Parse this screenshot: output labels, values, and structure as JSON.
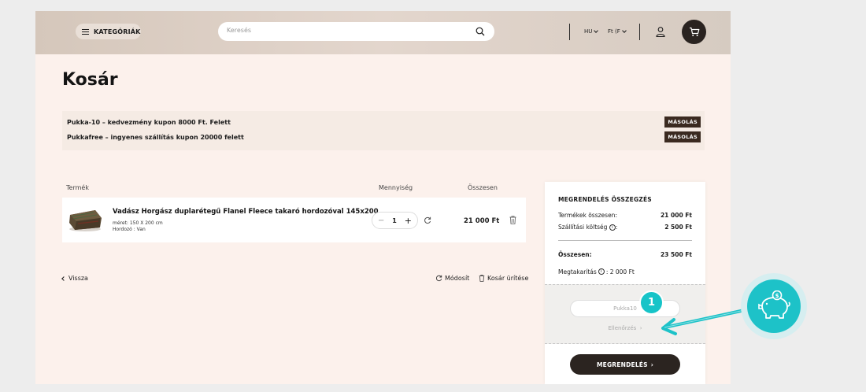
{
  "header": {
    "categories_label": "KATEGÓRIÁK",
    "search_placeholder": "Keresés",
    "language": "HU",
    "currency": "Ft (F"
  },
  "page_title": "Kosár",
  "coupons": [
    {
      "text": "Pukka-10 – kedvezmény kupon 8000 Ft. Felett",
      "button": "MÁSOLÁS"
    },
    {
      "text": "Pukkafree – ingyenes szállítás kupon 20000 felett",
      "button": "MÁSOLÁS"
    }
  ],
  "table": {
    "col_product": "Termék",
    "col_quantity": "Mennyiség",
    "col_total": "Összesen"
  },
  "product": {
    "name": "Vadász Horgász duplarétegű Flanel Fleece takaró hordozóval 145x200",
    "meta_size": "méret: 150 X 200 cm",
    "meta_carrier": "Hordozó : Van",
    "quantity": "1",
    "total": "21 000 Ft"
  },
  "actions": {
    "back": "Vissza",
    "modify": "Módosít",
    "clear": "Kosár ürítése"
  },
  "summary": {
    "title": "MEGRENDELÉS ÖSSZEGZÉS",
    "products_label": "Termékek összesen:",
    "products_value": "21 000 Ft",
    "shipping_label": "Szállítási költség",
    "shipping_value": "2 500 Ft",
    "total_label": "Összesen:",
    "total_value": "23 500 Ft",
    "savings_label": "Megtakarítás",
    "savings_value": ": 2 000 Ft",
    "coupon_value": "Pukka10",
    "check_label": "Ellenőrzés",
    "order_button": "MEGRENDELÉS"
  },
  "overlay": {
    "step_number": "1",
    "accent_color": "#1dc2c8"
  }
}
